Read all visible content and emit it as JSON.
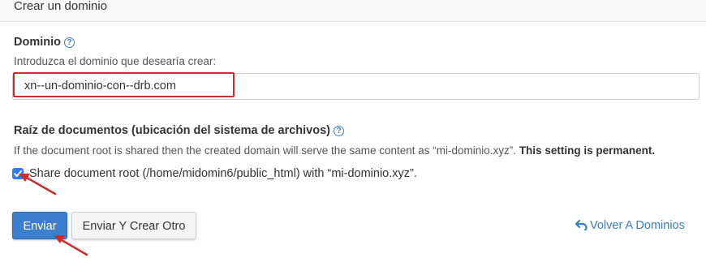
{
  "header": {
    "title": "Crear un dominio"
  },
  "domain": {
    "label": "Dominio",
    "help_icon": "?",
    "description": "Introduzca el dominio que desearía crear:",
    "value": "xn--un-dominio-con--drb.com"
  },
  "docroot": {
    "label": "Raíz de documentos (ubicación del sistema de archivos)",
    "help_icon": "?",
    "description": "If the document root is shared then the created domain will serve the same content as “mi-dominio.xyz”.",
    "permanent_note": "This setting is permanent.",
    "checkbox_checked": true,
    "checkbox_label": "Share document root (/home/midomin6/public_html) with “mi-dominio.xyz”."
  },
  "actions": {
    "submit_label": "Enviar",
    "submit_another_label": "Enviar Y Crear Otro",
    "back_label": "Volver A Dominios"
  },
  "colors": {
    "accent": "#3d7fcf",
    "link": "#3b7dc4",
    "highlight": "#c8302f",
    "checkbox": "#2e7cf6"
  },
  "icons": {
    "help": "question-circle-icon",
    "back": "undo-arrow-icon",
    "check": "checkmark-icon"
  }
}
